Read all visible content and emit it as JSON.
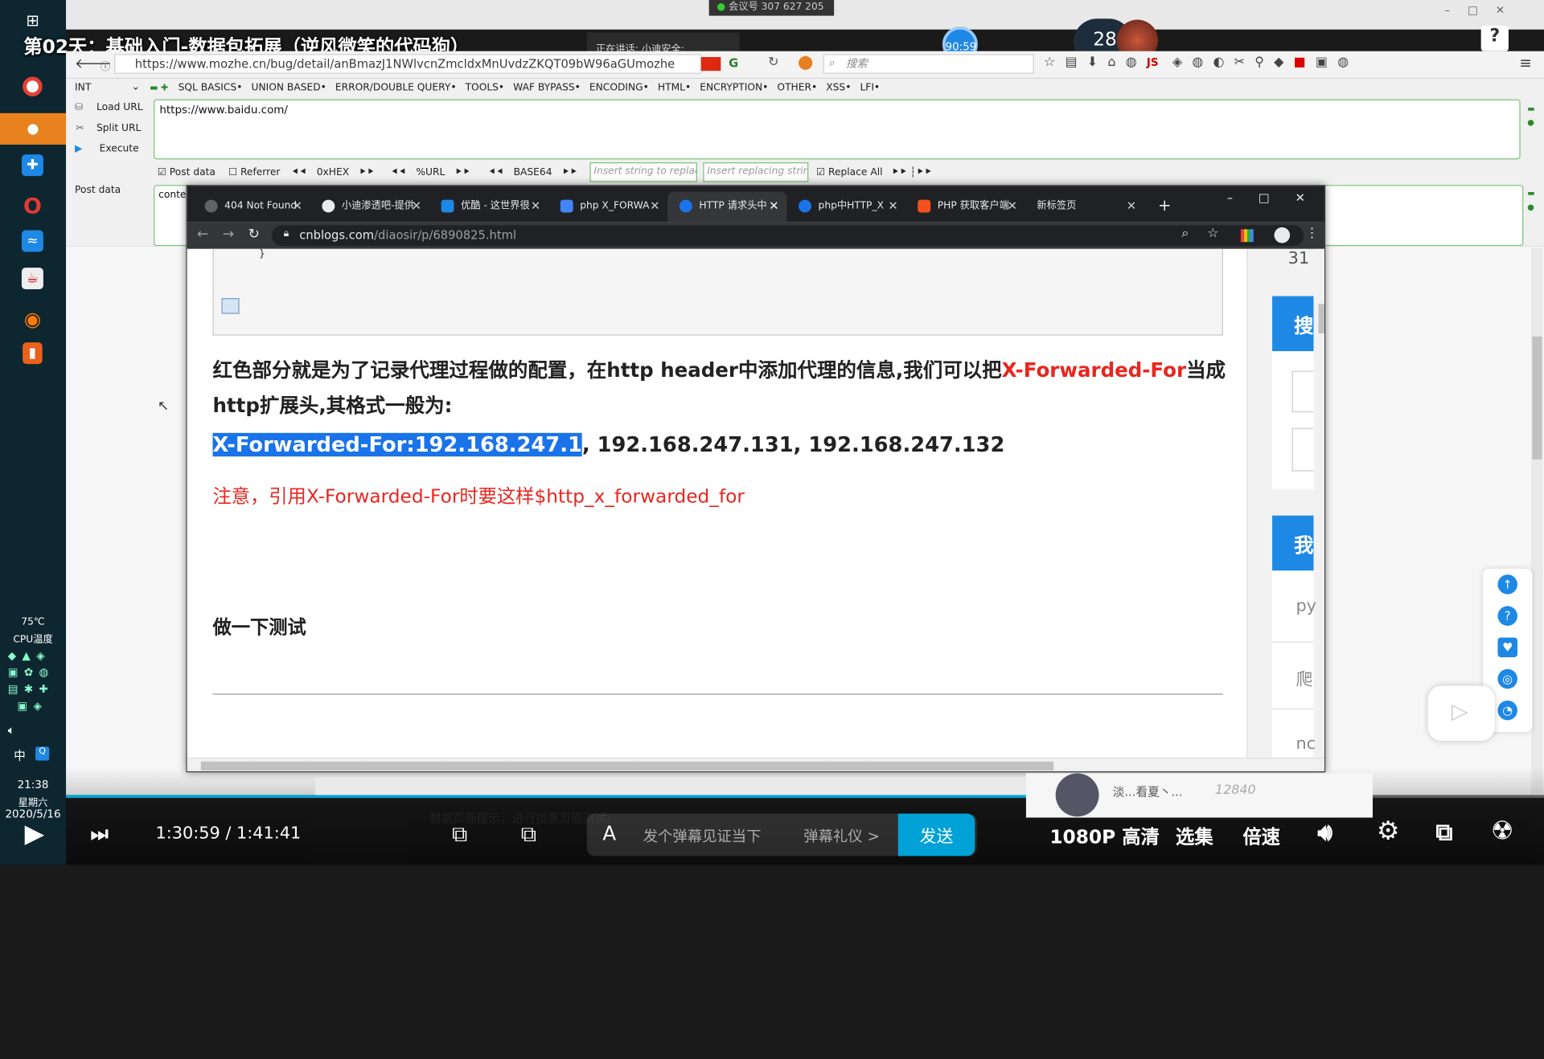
{
  "video": {
    "title": "第02天：基础入门-数据包拓展（逆风微笑的代码狗）",
    "meeting_label": "会议号 307 627 205",
    "speaking_toast": "正在讲话: 小迪安全;",
    "timer_badge": "90:59",
    "bubble_number": "28",
    "bubble_suffix": "%"
  },
  "windows_taskbar": {
    "temperature": "75℃",
    "cpu_label": "CPU温度",
    "ime": "中",
    "time": "21:38",
    "weekday": "星期六",
    "date": "2020/5/16"
  },
  "firefox": {
    "url": "https://www.mozhe.cn/bug/detail/anBmazJ1NWlvcnZmcldxMnUvdzZKQT09bW96aGUmozhe",
    "search_placeholder": "搜索"
  },
  "hackbar": {
    "int_select": "INT",
    "menu": [
      "SQL BASICS•",
      "UNION BASED•",
      "ERROR/DOUBLE QUERY•",
      "TOOLS•",
      "WAF BYPASS•",
      "ENCODING•",
      "HTML•",
      "ENCRYPTION•",
      "OTHER•",
      "XSS•",
      "LFI•"
    ],
    "load_url": "Load URL",
    "split_url": "Split URL",
    "execute": "Execute",
    "url_value": "https://www.baidu.com/",
    "post_data_check": "Post data",
    "referrer_check": "Referrer",
    "hex": "0xHEX",
    "url_enc": "%URL",
    "base64": "BASE64",
    "replace_placeholder": "Insert string to replace",
    "replacing_placeholder": "Insert replacing string",
    "replace_all": "Replace All",
    "post_label": "Post data",
    "post_value": "conte"
  },
  "chrome": {
    "tabs": [
      {
        "label": "404 Not Found",
        "color": "#5f6368"
      },
      {
        "label": "小迪渗透吧-提供",
        "color": "#e8eaed"
      },
      {
        "label": "优酷 - 这世界很",
        "color": "#1e88e5"
      },
      {
        "label": "php X_FORWA",
        "color": "#4285f4"
      },
      {
        "label": "HTTP 请求头中",
        "color": "#1a73e8"
      },
      {
        "label": "php中HTTP_X",
        "color": "#1a73e8"
      },
      {
        "label": "PHP 获取客户端",
        "color": "#f4511e"
      },
      {
        "label": "新标签页",
        "color": "#5f6368"
      }
    ],
    "new_tab": "+",
    "address_host": "cnblogs.com",
    "address_path": "/diaosir/p/6890825.html"
  },
  "article": {
    "para1_a": "红色部分就是为了记录代理过程做的配置，在http header中添加代理的信息,我们可以把",
    "para1_red": "X-Forwarded-For",
    "para1_b": "当成http扩展头,其格式一般为:",
    "header_selected": "X-Forwarded-For:192.168.247.1",
    "header_rest": ", 192.168.247.131, 192.168.247.132",
    "note": "注意，引用X-Forwarded-For时要这样$http_x_forwarded_for",
    "heading": "做一下测试",
    "side_number": "31",
    "side_btn1": "搜",
    "side_btn2": "我",
    "side_t1": "py",
    "side_t2": "爬",
    "side_t3": "nc"
  },
  "player": {
    "current_time": "1:30:59",
    "sep": "/",
    "total_time": "1:41:41",
    "subtitle": "根据页面提示，进行投票页面测试。",
    "danmaku_placeholder": "发个弹幕见证当下",
    "gift": "弹幕礼仪 >",
    "send": "发送",
    "quality": "1080P 高清",
    "episodes": "选集",
    "speed": "倍速",
    "comment_user": "淡...看夏丶...",
    "comment_score": "12840"
  },
  "colors": {
    "accent": "#00a1d6",
    "highlight": "#1a73e8",
    "article_red": "#e8261f"
  }
}
